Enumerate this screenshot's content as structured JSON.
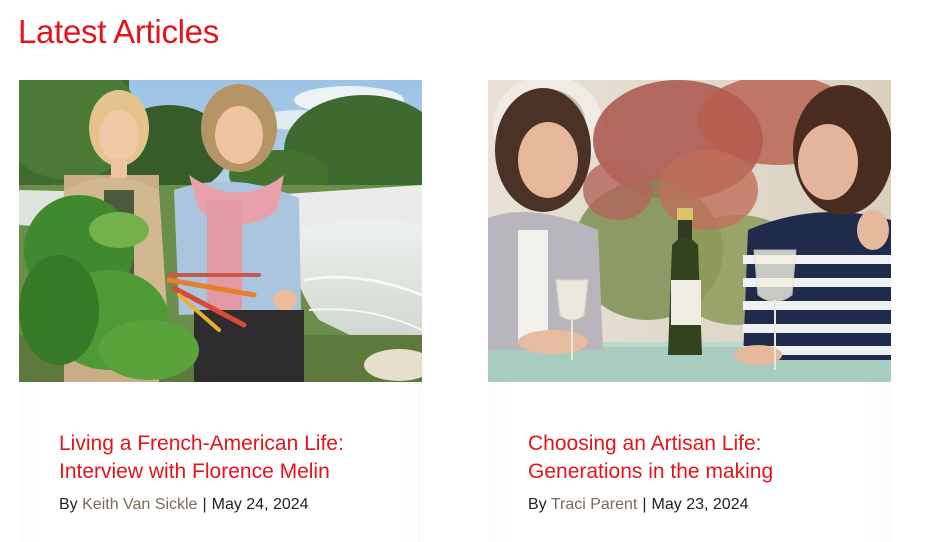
{
  "section_title": "Latest Articles",
  "articles": [
    {
      "title_line1": "Living a French-American Life:",
      "title_line2": "Interview with Florence Melin",
      "by_label": "By",
      "author": "Keith Van Sickle",
      "separator": "|",
      "date": "May 24, 2024"
    },
    {
      "title_line1": "Choosing an Artisan Life:",
      "title_line2": "Generations in the making",
      "by_label": "By",
      "author": "Traci Parent",
      "separator": "|",
      "date": "May 23, 2024"
    }
  ],
  "colors": {
    "accent_red": "#e4141b",
    "author_brown": "#7a6a58",
    "text_dark": "#222222"
  }
}
